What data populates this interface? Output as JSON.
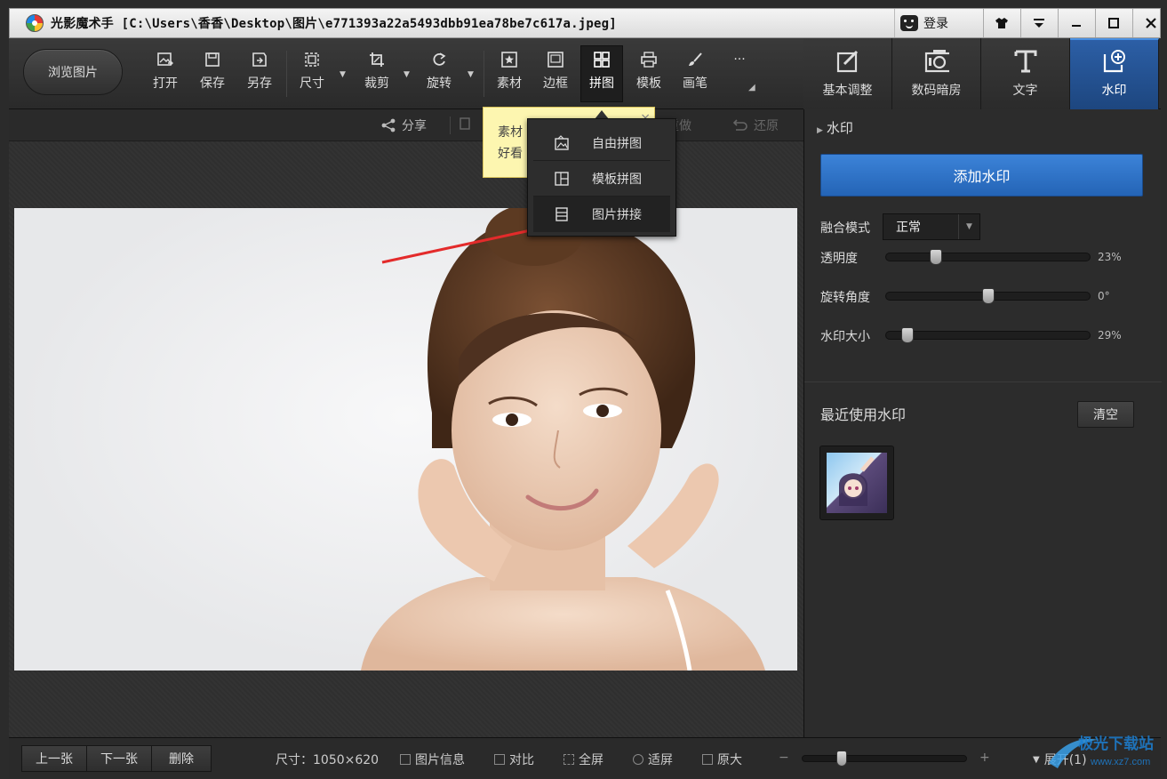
{
  "titlebar": {
    "title": "光影魔术手 [C:\\Users\\香香\\Desktop\\图片\\e771393a22a5493dbb91ea78be7c617a.jpeg]",
    "login_label": "登录",
    "controls": [
      "skin",
      "menu",
      "minimize",
      "maximize",
      "close"
    ]
  },
  "toolbar": {
    "browse_label": "浏览图片",
    "tools": [
      {
        "label": "打开",
        "icon": "open-image-icon"
      },
      {
        "label": "保存",
        "icon": "save-icon"
      },
      {
        "label": "另存",
        "icon": "save-as-icon"
      },
      {
        "label": "尺寸",
        "icon": "resize-icon"
      },
      {
        "label": "裁剪",
        "icon": "crop-icon"
      },
      {
        "label": "旋转",
        "icon": "rotate-icon"
      },
      {
        "label": "素材",
        "icon": "material-icon"
      },
      {
        "label": "边框",
        "icon": "border-icon"
      },
      {
        "label": "拼图",
        "icon": "collage-icon"
      },
      {
        "label": "模板",
        "icon": "template-icon"
      },
      {
        "label": "画笔",
        "icon": "brush-icon"
      },
      {
        "label": "···",
        "icon": "more-icon"
      }
    ]
  },
  "right_tabs": [
    {
      "label": "基本调整",
      "icon": "basic-adjust-icon"
    },
    {
      "label": "数码暗房",
      "icon": "camera-icon"
    },
    {
      "label": "文字",
      "icon": "text-icon"
    },
    {
      "label": "水印",
      "icon": "watermark-icon"
    }
  ],
  "share_bar": {
    "share": "分享",
    "redo": "重做",
    "restore": "还原"
  },
  "tooltip": {
    "line1": "素材",
    "line2": "好看",
    "close": "×"
  },
  "collage_menu": [
    {
      "label": "自由拼图",
      "icon": "free-collage-icon"
    },
    {
      "label": "模板拼图",
      "icon": "template-collage-icon"
    },
    {
      "label": "图片拼接",
      "icon": "photo-stitch-icon"
    }
  ],
  "watermark_panel": {
    "section_title": "水印",
    "add_button": "添加水印",
    "blend_label": "融合模式",
    "blend_value": "正常",
    "sliders": [
      {
        "label": "透明度",
        "value": 0.23,
        "display": "23%"
      },
      {
        "label": "旋转角度",
        "value": 0.5,
        "display": "0°"
      },
      {
        "label": "水印大小",
        "value": 0.08,
        "display": "29%"
      }
    ],
    "recent_title": "最近使用水印",
    "clear_button": "清空"
  },
  "statusbar": {
    "prev": "上一张",
    "next": "下一张",
    "delete": "删除",
    "size": "尺寸：1050×620",
    "info": "图片信息",
    "compare": "对比",
    "fullscreen": "全屏",
    "fit": "适屏",
    "original": "原大",
    "zoom_level": 0.22,
    "expand": "展开(1)"
  },
  "overlay_logo": {
    "line1": "极光下载站",
    "line2": "www.xz7.com"
  },
  "colors": {
    "accent_blue": "#2e6fc7",
    "tooltip_yellow": "#fdf6b0",
    "arrow_red": "#e32b2b"
  }
}
